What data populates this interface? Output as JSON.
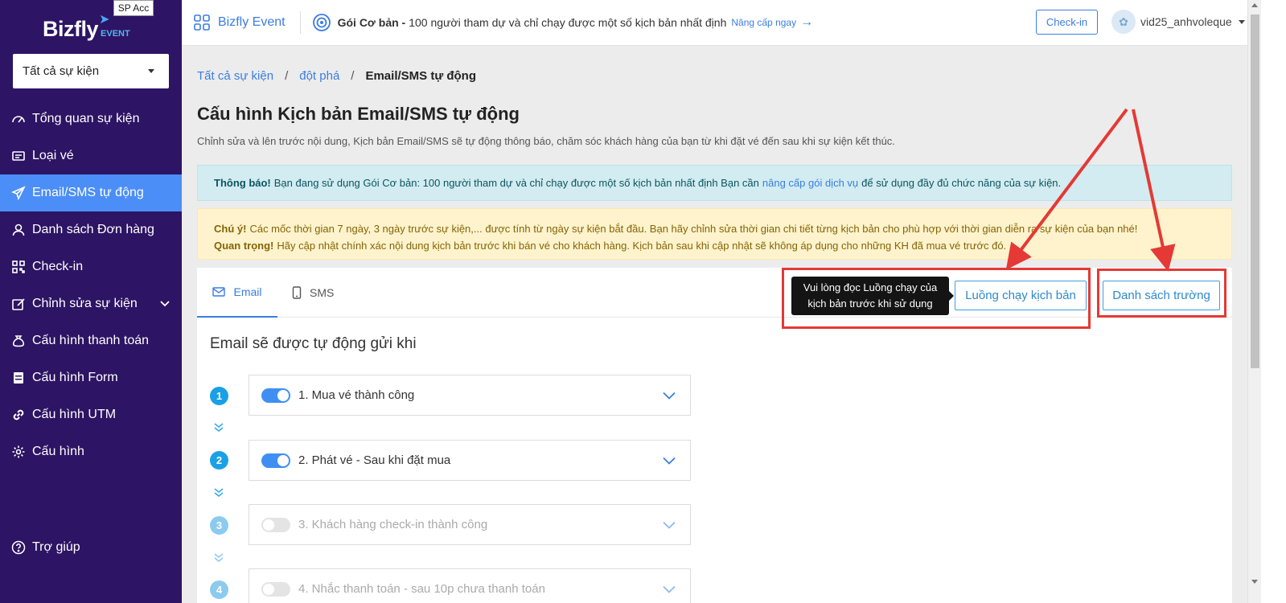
{
  "brand": {
    "logo": "Bizfly",
    "logo_suffix": "EVENT",
    "account_badge": "SP Acc"
  },
  "event_select": {
    "value": "Tất cả sự kiện"
  },
  "sidebar": {
    "items": [
      {
        "label": "Tổng quan sự kiện",
        "icon": "dashboard-icon"
      },
      {
        "label": "Loại vé",
        "icon": "ticket-icon"
      },
      {
        "label": "Email/SMS tự động",
        "icon": "send-icon",
        "active": true
      },
      {
        "label": "Danh sách Đơn hàng",
        "icon": "user-icon"
      },
      {
        "label": "Check-in",
        "icon": "qrcode-icon"
      },
      {
        "label": "Chỉnh sửa sự kiện",
        "icon": "edit-icon"
      },
      {
        "label": "Cấu hình thanh toán",
        "icon": "money-bag-icon"
      },
      {
        "label": "Cấu hình Form",
        "icon": "form-icon"
      },
      {
        "label": "Cấu hình UTM",
        "icon": "link-icon"
      },
      {
        "label": "Cấu hình",
        "icon": "gear-icon"
      }
    ],
    "help": "Trợ giúp"
  },
  "topbar": {
    "app_name": "Bizfly Event",
    "plan_name": "Gói Cơ bản -",
    "plan_desc": "100 người tham dự và chỉ chạy được một số kịch bản nhất định",
    "upgrade": "Nâng cấp ngay",
    "checkin": "Check-in",
    "username": "vid25_anhvoleque"
  },
  "breadcrumb": {
    "root": "Tất cả sự kiện",
    "event": "đột phá",
    "current": "Email/SMS tự động"
  },
  "page": {
    "title": "Cấu hình Kịch bản Email/SMS tự động",
    "description": "Chỉnh sửa và lên trước nội dung, Kịch bản Email/SMS sẽ tự động thông báo, chăm sóc khách hàng của bạn từ khi đặt vé đến sau khi sự kiện kết thúc."
  },
  "alert_info": {
    "label": "Thông báo!",
    "text_before": "Bạn đang sử dụng Gói Cơ bản: 100 người tham dự và chỉ chạy được một số kịch bản nhất định Bạn cần",
    "link": "nâng cấp gói dịch vụ",
    "text_after": "để sử dụng đầy đủ chức năng của sự kiện."
  },
  "alert_warn": {
    "label1": "Chú ý!",
    "text1": "Các mốc thời gian 7 ngày, 3 ngày trước sự kiện,... được tính từ ngày sự kiện bắt đầu. Bạn hãy chỉnh sửa thời gian chi tiết từng kịch bản cho phù hợp với thời gian diễn ra sự kiện của bạn nhé!",
    "label2": "Quan trọng!",
    "text2": "Hãy cập nhật chính xác nội dung kịch bản trước khi bán vé cho khách hàng. Kịch bản sau khi cập nhật sẽ không áp dụng cho những KH đã mua vé trước đó."
  },
  "tabs": {
    "email": "Email",
    "sms": "SMS"
  },
  "tooltip": {
    "line1": "Vui lòng đọc Luồng chạy của",
    "line2": "kịch bản trước khi sử dụng"
  },
  "buttons": {
    "flow": "Luồng chạy kịch bản",
    "fields": "Danh sách trường"
  },
  "section_title": "Email sẽ được tự động gửi khi",
  "steps": [
    {
      "num": "1",
      "label": "1. Mua vé thành công",
      "enabled": true
    },
    {
      "num": "2",
      "label": "2. Phát vé - Sau khi đặt mua",
      "enabled": true
    },
    {
      "num": "3",
      "label": "3. Khách hàng check-in thành công",
      "enabled": false
    },
    {
      "num": "4",
      "label": "4. Nhắc thanh toán - sau 10p chưa thanh toán",
      "enabled": false
    }
  ],
  "colors": {
    "sidebar": "#2d1464",
    "active": "#4b8ef7",
    "accent": "#3b7de0",
    "annotation": "#e53935"
  }
}
